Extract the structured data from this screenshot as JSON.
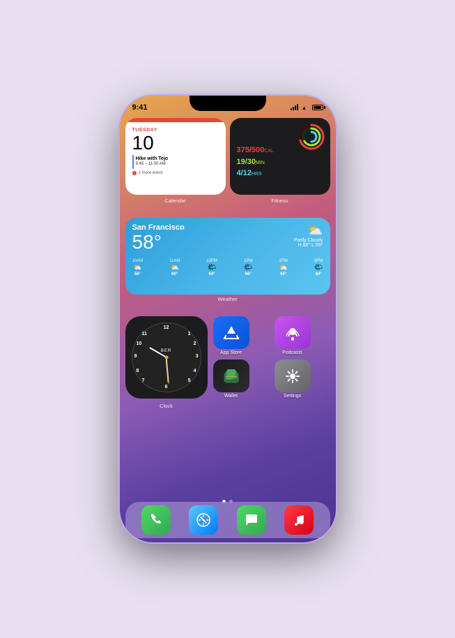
{
  "phone": {
    "status_bar": {
      "time": "9:41",
      "signal": "signal",
      "wifi": "wifi",
      "battery": "battery"
    },
    "widgets": {
      "calendar": {
        "day_name": "TUESDAY",
        "date": "10",
        "event_title": "Hike with Tejo",
        "event_time": "9:45 – 11:00 AM",
        "more_events": "1 more event",
        "label": "Calendar"
      },
      "fitness": {
        "calories": "375/500",
        "cal_unit": "CAL",
        "minutes": "19/30",
        "min_unit": "MIN",
        "hours": "4/12",
        "hrs_unit": "HRS",
        "label": "Fitness"
      },
      "weather": {
        "city": "San Francisco",
        "temp": "58°",
        "condition": "Partly Cloudy",
        "high": "H:66°",
        "low": "L:55°",
        "forecast": [
          {
            "time": "10AM",
            "temp": "58°"
          },
          {
            "time": "11AM",
            "temp": "60°"
          },
          {
            "time": "12PM",
            "temp": "64°"
          },
          {
            "time": "1PM",
            "temp": "66°"
          },
          {
            "time": "2PM",
            "temp": "66°"
          },
          {
            "time": "3PM",
            "temp": "64°"
          }
        ],
        "label": "Weather"
      },
      "clock": {
        "city": "BER",
        "label": "Clock"
      }
    },
    "apps": [
      {
        "name": "App Store",
        "type": "appstore"
      },
      {
        "name": "Podcasts",
        "type": "podcasts"
      },
      {
        "name": "Wallet",
        "type": "wallet"
      },
      {
        "name": "Settings",
        "type": "settings"
      }
    ],
    "dock": [
      {
        "name": "Phone",
        "type": "phone"
      },
      {
        "name": "Safari",
        "type": "safari"
      },
      {
        "name": "Messages",
        "type": "messages"
      },
      {
        "name": "Music",
        "type": "music"
      }
    ],
    "page_dots": [
      "active",
      "inactive"
    ]
  }
}
